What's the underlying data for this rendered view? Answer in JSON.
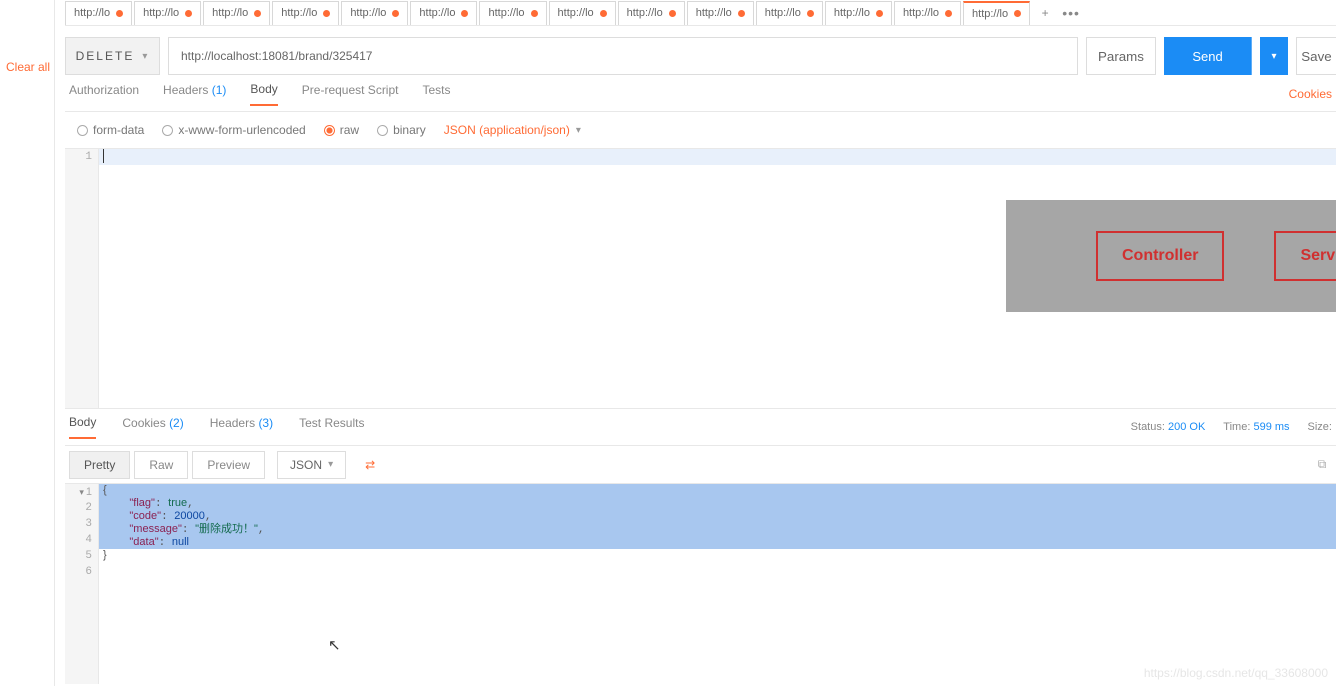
{
  "sidebar": {
    "clear_all": "Clear all"
  },
  "tabs": {
    "items": [
      {
        "label": "http://lo"
      },
      {
        "label": "http://lo"
      },
      {
        "label": "http://lo"
      },
      {
        "label": "http://lo"
      },
      {
        "label": "http://lo"
      },
      {
        "label": "http://lo"
      },
      {
        "label": "http://lo"
      },
      {
        "label": "http://lo"
      },
      {
        "label": "http://lo"
      },
      {
        "label": "http://lo"
      },
      {
        "label": "http://lo"
      },
      {
        "label": "http://lo"
      },
      {
        "label": "http://lo"
      },
      {
        "label": "http://lo"
      }
    ],
    "plus": "+",
    "more": "•••"
  },
  "request": {
    "method": "DELETE",
    "url": "http://localhost:18081/brand/325417",
    "params": "Params",
    "send": "Send",
    "save": "Save"
  },
  "req_tabs": {
    "authorization": "Authorization",
    "headers": "Headers",
    "headers_count": "(1)",
    "body": "Body",
    "prerequest": "Pre-request Script",
    "tests": "Tests",
    "cookies_link": "Cookies"
  },
  "body_types": {
    "form_data": "form-data",
    "urlencoded": "x-www-form-urlencoded",
    "raw": "raw",
    "binary": "binary",
    "content_type": "JSON (application/json)"
  },
  "overlay": {
    "controller": "Controller",
    "service": "Service"
  },
  "resp_tabs": {
    "body": "Body",
    "cookies": "Cookies",
    "cookies_count": "(2)",
    "headers": "Headers",
    "headers_count": "(3)",
    "tests": "Test Results"
  },
  "resp_meta": {
    "status_label": "Status:",
    "status_val": "200 OK",
    "time_label": "Time:",
    "time_val": "599 ms",
    "size_label": "Size:"
  },
  "resp_toolbar": {
    "pretty": "Pretty",
    "raw": "Raw",
    "preview": "Preview",
    "format": "JSON"
  },
  "response_json": {
    "l1": "{",
    "l2_key": "\"flag\"",
    "l2_val": "true",
    "l3_key": "\"code\"",
    "l3_val": "20000",
    "l4_key": "\"message\"",
    "l4_val": "\"删除成功！\"",
    "l5_key": "\"data\"",
    "l5_val": "null",
    "l6": "}"
  },
  "gutter": {
    "n1": "1",
    "n2": "2",
    "n3": "3",
    "n4": "4",
    "n5": "5",
    "n6": "6"
  },
  "watermark": "https://blog.csdn.net/qq_33608000"
}
